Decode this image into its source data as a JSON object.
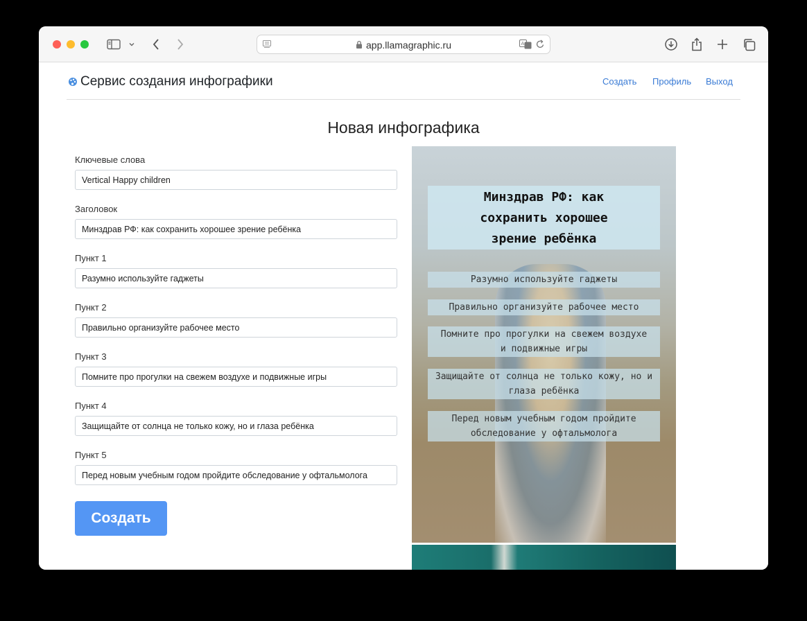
{
  "browser": {
    "url": "app.llamagraphic.ru"
  },
  "nav": {
    "brand": "Сервис создания инфографики",
    "links": [
      "Создать",
      "Профиль",
      "Выход"
    ]
  },
  "form": {
    "title": "Новая инфографика",
    "fields": [
      {
        "label": "Ключевые слова",
        "value": "Vertical Happy children"
      },
      {
        "label": "Заголовок",
        "value": "Минздрав РФ: как сохранить хорошее зрение ребёнка"
      },
      {
        "label": "Пункт 1",
        "value": "Разумно используйте гаджеты"
      },
      {
        "label": "Пункт 2",
        "value": "Правильно организуйте рабочее место"
      },
      {
        "label": "Пункт 3",
        "value": "Помните про прогулки на свежем воздухе и подвижные игры"
      },
      {
        "label": "Пункт 4",
        "value": "Защищайте от солнца не только кожу, но и глаза ребёнка"
      },
      {
        "label": "Пункт 5",
        "value": "Перед новым учебным годом пройдите обследование у офтальмолога"
      }
    ],
    "submit_label": "Создать"
  },
  "preview": {
    "title_lines": [
      "Минздрав РФ: как",
      "сохранить хорошее",
      "зрение ребёнка"
    ],
    "items": [
      [
        "Разумно используйте гаджеты"
      ],
      [
        "Правильно организуйте рабочее место"
      ],
      [
        "Помните про прогулки на свежем воздухе",
        "и подвижные игры"
      ],
      [
        "Защищайте от солнца не только кожу, но и",
        "глаза ребёнка"
      ],
      [
        "Перед новым учебным годом пройдите",
        "обследование у офтальмолога"
      ]
    ]
  }
}
